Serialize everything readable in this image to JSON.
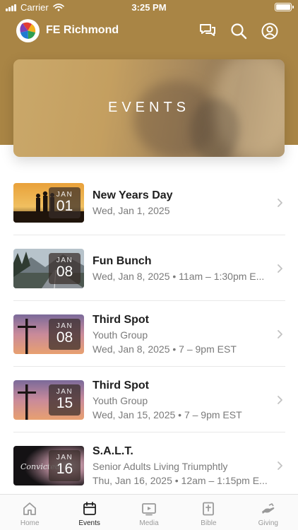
{
  "status": {
    "carrier": "Carrier",
    "time": "3:25 PM"
  },
  "app": {
    "title": "FE Richmond"
  },
  "header_icons": [
    "chat-bubbles-icon",
    "search-icon",
    "profile-icon"
  ],
  "hero": {
    "title": "EVENTS"
  },
  "events": [
    {
      "title": "New Years Day",
      "lines": [
        "Wed, Jan 1, 2025"
      ],
      "month": "JAN",
      "day": "01",
      "thumb": "sunset-silhouettes"
    },
    {
      "title": "Fun Bunch",
      "lines": [
        "Wed, Jan 8, 2025 • 11am – 1:30pm E..."
      ],
      "month": "JAN",
      "day": "08",
      "thumb": "mountain-road"
    },
    {
      "title": "Third Spot",
      "lines": [
        "Youth Group",
        "Wed, Jan 8, 2025 • 7 – 9pm EST"
      ],
      "month": "JAN",
      "day": "08",
      "thumb": "cross-sunset"
    },
    {
      "title": "Third Spot",
      "lines": [
        "Youth Group",
        "Wed, Jan 15, 2025 • 7 – 9pm EST"
      ],
      "month": "JAN",
      "day": "15",
      "thumb": "cross-sunset"
    },
    {
      "title": "S.A.L.T.",
      "lines": [
        "Senior Adults Living Triumphtly",
        "Thu, Jan 16, 2025 • 12am – 1:15pm E..."
      ],
      "month": "JAN",
      "day": "16",
      "thumb": "convicted",
      "thumb_text": "Convicted"
    }
  ],
  "tabs": [
    {
      "label": "Home",
      "icon": "home-icon",
      "active": false
    },
    {
      "label": "Events",
      "icon": "calendar-icon",
      "active": true
    },
    {
      "label": "Media",
      "icon": "media-play-icon",
      "active": false
    },
    {
      "label": "Bible",
      "icon": "bible-icon",
      "active": false
    },
    {
      "label": "Giving",
      "icon": "giving-hand-icon",
      "active": false
    }
  ],
  "colors": {
    "header": "#a98545",
    "tab_active": "#1e1e1e",
    "tab_inactive": "#9a9a9a"
  }
}
